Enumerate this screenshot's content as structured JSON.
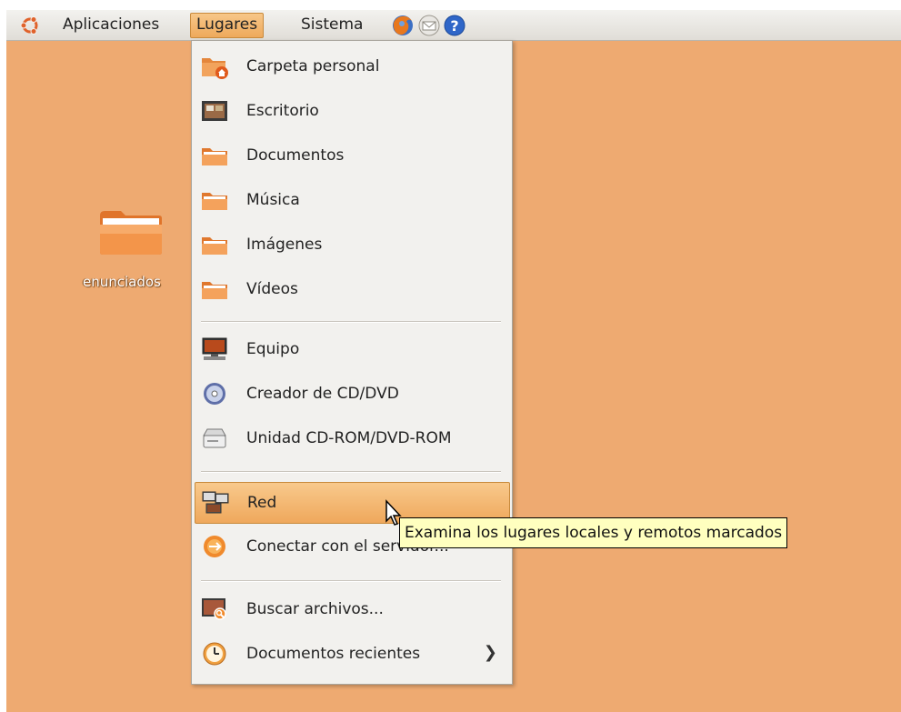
{
  "panel": {
    "menus": [
      "Aplicaciones",
      "Lugares",
      "Sistema"
    ],
    "active_menu": "Lugares",
    "launchers": [
      "firefox-icon",
      "mail-icon",
      "help-icon"
    ]
  },
  "desktop": {
    "icons": [
      {
        "label": "enunciados",
        "icon": "folder-icon"
      }
    ]
  },
  "menu": {
    "items": [
      {
        "label": "Carpeta personal",
        "icon": "home-folder-icon"
      },
      {
        "label": "Escritorio",
        "icon": "desktop-folder-icon"
      },
      {
        "label": "Documentos",
        "icon": "folder-icon"
      },
      {
        "label": "Música",
        "icon": "folder-icon"
      },
      {
        "label": "Imágenes",
        "icon": "folder-icon"
      },
      {
        "label": "Vídeos",
        "icon": "folder-icon"
      },
      {
        "label": "Equipo",
        "icon": "computer-icon"
      },
      {
        "label": "Creador de CD/DVD",
        "icon": "cd-burner-icon"
      },
      {
        "label": "Unidad CD-ROM/DVD-ROM",
        "icon": "optical-drive-icon"
      },
      {
        "label": "Red",
        "icon": "network-icon",
        "highlighted": true
      },
      {
        "label": "Conectar con el servidor...",
        "icon": "connect-server-icon"
      },
      {
        "label": "Buscar archivos...",
        "icon": "search-files-icon"
      },
      {
        "label": "Documentos recientes",
        "icon": "recent-documents-icon",
        "submenu": true
      }
    ]
  },
  "tooltip": {
    "text": "Examina los lugares locales y remotos marcados"
  },
  "colors": {
    "desktop_bg": "#eeaa71",
    "highlight": "#efa85c",
    "tooltip_bg": "#ffffbf"
  }
}
